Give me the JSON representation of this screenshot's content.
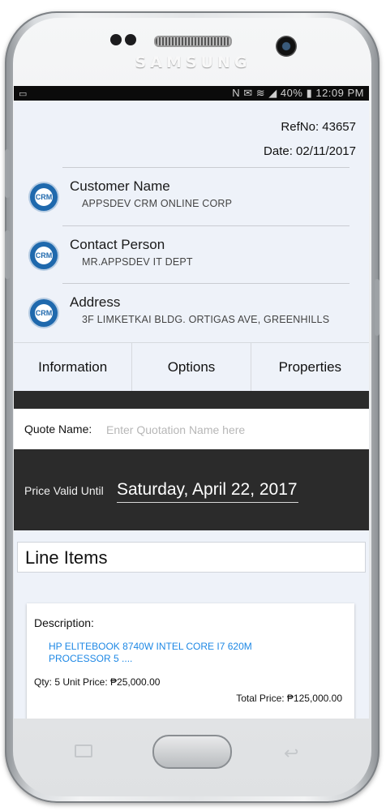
{
  "device": {
    "brand": "SAMSUNG"
  },
  "statusbar": {
    "left_icon": "notification-icon",
    "indicators": "N ✉ ≋ ◢",
    "battery": "40%",
    "time": "12:09 PM"
  },
  "header": {
    "refno_label": "RefNo: 43657",
    "date_label": "Date: 02/11/2017"
  },
  "info": {
    "customer": {
      "title": "Customer Name",
      "value": "APPSDEV CRM ONLINE CORP",
      "icon": "crm-icon"
    },
    "contact": {
      "title": "Contact Person",
      "value": "MR.APPSDEV  IT DEPT",
      "icon": "crm-icon"
    },
    "address": {
      "title": "Address",
      "value": "3F LIMKETKAI BLDG. ORTIGAS AVE, GREENHILLS",
      "icon": "crm-icon"
    },
    "icon_text": "CRM"
  },
  "tabs": [
    "Information",
    "Options",
    "Properties"
  ],
  "quote": {
    "label": "Quote Name:",
    "placeholder": "Enter Quotation Name here"
  },
  "price_valid": {
    "label": "Price Valid Until",
    "date": "Saturday, April 22, 2017"
  },
  "line_items": {
    "title": "Line Items",
    "items": [
      {
        "description_label": "Description:",
        "description": "HP ELITEBOOK 8740W INTEL CORE I7 620M PROCESSOR 5 ....",
        "qty_unit": "Qty: 5   Unit Price: ₱25,000.00",
        "total": "Total Price: ₱125,000.00"
      }
    ]
  },
  "colors": {
    "screen_bg": "#eef2f9",
    "dark_band": "#2b2b2b",
    "icon_blue": "#1f69ad",
    "link_blue": "#1e88e5"
  }
}
